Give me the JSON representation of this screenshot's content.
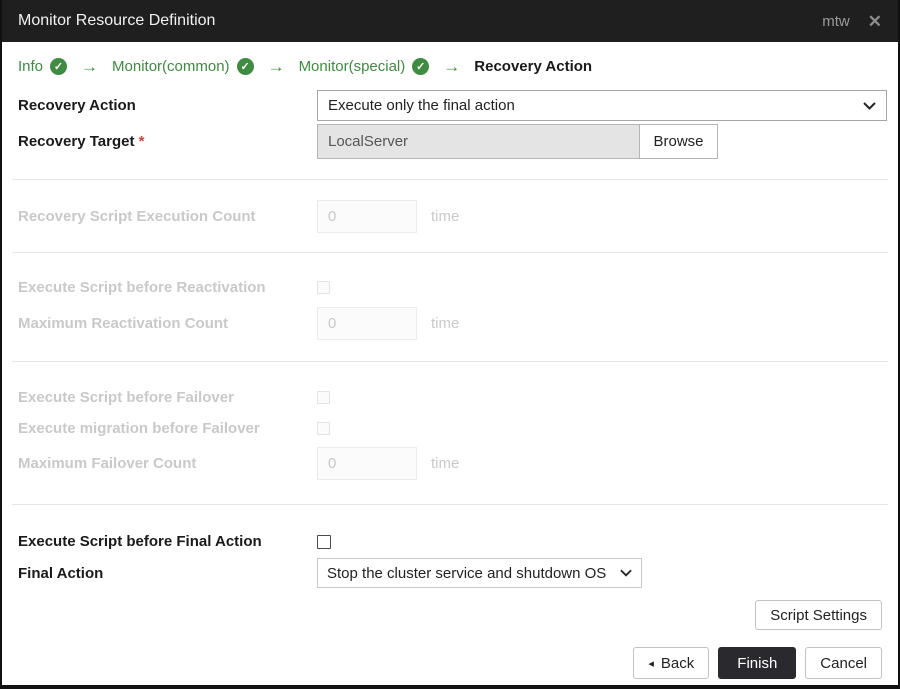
{
  "dialog": {
    "title": "Monitor Resource Definition",
    "window_badge": "mtw",
    "close_glyph": "✕"
  },
  "colors": {
    "titlebar_bg": "#1f1f1f",
    "accent_green": "#3e8b41",
    "required_red": "#d43f3a",
    "finish_button_bg": "#2a2a2e"
  },
  "steps": {
    "check_glyph": "✓",
    "arrow_glyph": "→",
    "items": [
      {
        "label": "Info",
        "done": true
      },
      {
        "label": "Monitor(common)",
        "done": true
      },
      {
        "label": "Monitor(special)",
        "done": true
      },
      {
        "label": "Recovery Action",
        "done": false,
        "current": true
      }
    ]
  },
  "form": {
    "recovery_action": {
      "label": "Recovery Action",
      "value": "Execute only the final action"
    },
    "recovery_target": {
      "label": "Recovery Target",
      "required_mark": "*",
      "value": "LocalServer",
      "browse_label": "Browse"
    },
    "recovery_script_execution_count": {
      "label": "Recovery Script Execution Count",
      "value": "0",
      "unit": "time",
      "disabled": true
    },
    "execute_script_before_reactivation": {
      "label": "Execute Script before Reactivation",
      "checked": false,
      "disabled": true
    },
    "maximum_reactivation_count": {
      "label": "Maximum Reactivation Count",
      "value": "0",
      "unit": "time",
      "disabled": true
    },
    "execute_script_before_failover": {
      "label": "Execute Script before Failover",
      "checked": false,
      "disabled": true
    },
    "execute_migration_before_failover": {
      "label": "Execute migration before Failover",
      "checked": false,
      "disabled": true
    },
    "maximum_failover_count": {
      "label": "Maximum Failover Count",
      "value": "0",
      "unit": "time",
      "disabled": true
    },
    "execute_script_before_final_action": {
      "label": "Execute Script before Final Action",
      "checked": false,
      "disabled": false
    },
    "final_action": {
      "label": "Final Action",
      "value": "Stop the cluster service and shutdown OS"
    }
  },
  "buttons": {
    "script_settings": "Script Settings",
    "back": "Back",
    "back_icon": "◂",
    "finish": "Finish",
    "cancel": "Cancel"
  }
}
